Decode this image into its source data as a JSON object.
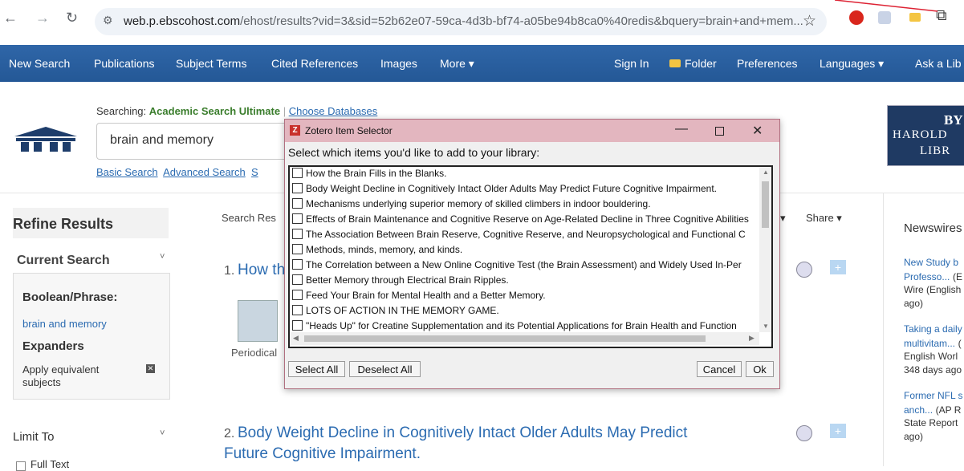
{
  "browser": {
    "url_host": "web.p.ebscohost.com",
    "url_rest": "/ehost/results?vid=3&sid=52b62e07-59ca-4d3b-bf74-a05be94b8ca0%40redis&bquery=brain+and+mem..."
  },
  "nav": {
    "items": [
      "New Search",
      "Publications",
      "Subject Terms",
      "Cited References",
      "Images",
      "More ▾"
    ],
    "right_items": [
      "Sign In",
      "Folder",
      "Preferences",
      "Languages ▾",
      "Ask a Lib"
    ]
  },
  "header": {
    "searching_label": "Searching:",
    "database": "Academic Search Ultimate",
    "choose_databases": "Choose Databases",
    "search_value": "brain and memory",
    "basic_search": "Basic Search",
    "advanced_search": "Advanced Search",
    "partial_link": "S",
    "logo_line1": "BY",
    "logo_line2": "HAROLD",
    "logo_line3": "LIBR"
  },
  "left": {
    "refine_results": "Refine Results",
    "current_search": "Current Search",
    "boolean_phrase": "Boolean/Phrase:",
    "query": "brain and memory",
    "expanders": "Expanders",
    "apply_equivalent": "Apply equivalent",
    "subjects": "subjects",
    "limit_to": "Limit To",
    "full_text": "Full Text"
  },
  "main": {
    "search_results": "Search Res",
    "share": "Share ▾",
    "result1_num": "1.",
    "result1_title": "How th",
    "periodical": "Periodical",
    "result2_num": "2.",
    "result2_title_line1": "Body Weight Decline in Cognitively Intact Older Adults May Predict",
    "result2_title_line2": "Future Cognitive Impairment."
  },
  "zotero": {
    "title": "Zotero Item Selector",
    "prompt": "Select which items you'd like to add to your library:",
    "items": [
      "How the Brain Fills in the Blanks.",
      "Body Weight Decline in Cognitively Intact Older Adults May Predict Future Cognitive Impairment.",
      "Mechanisms underlying superior memory of skilled climbers in indoor bouldering.",
      "Effects of Brain Maintenance and Cognitive Reserve on Age-Related Decline in Three Cognitive Abilities",
      "The Association Between Brain Reserve, Cognitive Reserve, and Neuropsychological and Functional C",
      "Methods, minds, memory, and kinds.",
      "The Correlation between a New Online Cognitive Test (the Brain Assessment) and Widely Used In-Per",
      "Better Memory through Electrical Brain Ripples.",
      "Feed Your Brain for Mental Health and a Better Memory.",
      "LOTS OF ACTION IN THE MEMORY GAME.",
      "\"Heads Up\" for Creatine Supplementation and its Potential Applications for Brain Health and Function"
    ],
    "select_all": "Select All",
    "deselect_all": "Deselect All",
    "cancel": "Cancel",
    "ok": "Ok"
  },
  "right": {
    "newswires": "Newswires",
    "n1_link": "New Study b",
    "n1_link2": "Professo...",
    "n1_text": "(E",
    "n1_text2": "Wire (English",
    "n1_text3": "ago)",
    "n2_link": "Taking a daily",
    "n2_link2": "multivitam...",
    "n2_text": "(",
    "n2_text2": "English Worl",
    "n2_text3": "348 days ago",
    "n3_link": "Former NFL s",
    "n3_link2": "anch...",
    "n3_text": "(AP R",
    "n3_text2": "State Report",
    "n3_text3": "ago)"
  }
}
